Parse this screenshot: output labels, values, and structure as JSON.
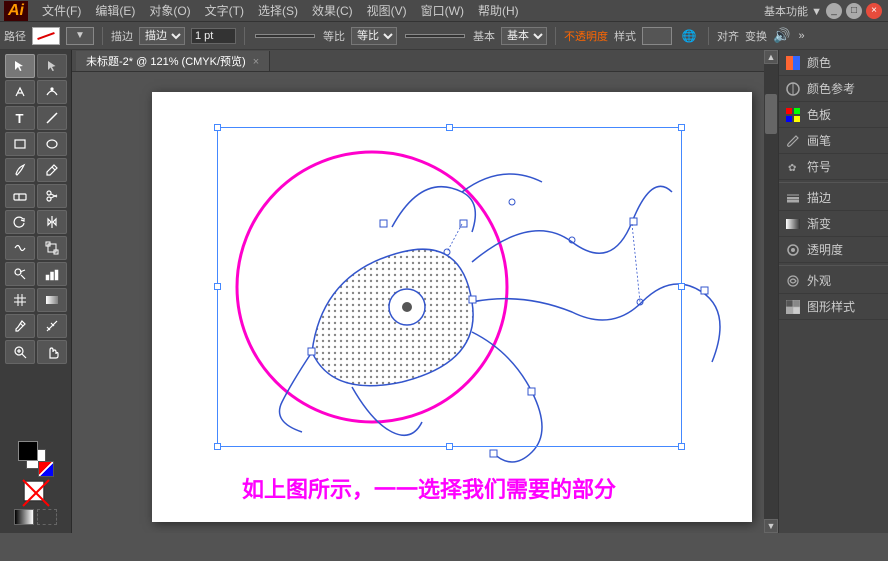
{
  "titlebar": {
    "logo": "Ai",
    "menus": [
      "文件(F)",
      "编辑(E)",
      "对象(O)",
      "文字(T)",
      "选择(S)",
      "效果(C)",
      "视图(V)",
      "窗口(W)",
      "帮助(H)"
    ],
    "profile": "基本功能 ▼",
    "win_buttons": [
      "_",
      "□",
      "×"
    ]
  },
  "toolbar1": {
    "path_label": "路径",
    "stroke_label": "描边",
    "weight_value": "1 pt",
    "blend_label": "等比",
    "opacity_label": "不透明度",
    "style_label": "样式",
    "align_label": "对齐",
    "transform_label": "变换"
  },
  "tabs": [
    {
      "label": "未标题-2* @ 121% (CMYK/预览)",
      "active": true
    }
  ],
  "rightpanel": {
    "items": [
      {
        "icon": "◩",
        "label": "颜色"
      },
      {
        "icon": "◨",
        "label": "颜色参考"
      },
      {
        "icon": "⊞",
        "label": "色板"
      },
      {
        "icon": "✏",
        "label": "画笔"
      },
      {
        "icon": "✿",
        "label": "符号"
      },
      {
        "icon": "—",
        "label": "描边"
      },
      {
        "icon": "▦",
        "label": "渐变"
      },
      {
        "icon": "◎",
        "label": "透明度"
      },
      {
        "icon": "◈",
        "label": "外观"
      },
      {
        "icon": "⬛",
        "label": "图形样式"
      }
    ]
  },
  "caption": {
    "text": "如上图所示，一一选择我们需要的部分"
  },
  "tools": [
    {
      "icon": "↖",
      "label": "selection-tool"
    },
    {
      "icon": "↗",
      "label": "direct-selection-tool"
    },
    {
      "icon": "✎",
      "label": "pen-tool"
    },
    {
      "icon": "T",
      "label": "type-tool"
    },
    {
      "icon": "◯",
      "label": "ellipse-tool"
    },
    {
      "icon": "⬜",
      "label": "rect-tool"
    },
    {
      "icon": "✂",
      "label": "scissors-tool"
    },
    {
      "icon": "⬡",
      "label": "rotate-tool"
    },
    {
      "icon": "↕",
      "label": "scale-tool"
    },
    {
      "icon": "✱",
      "label": "blend-tool"
    },
    {
      "icon": "🖊",
      "label": "pencil-tool"
    },
    {
      "icon": "⊕",
      "label": "symbol-tool"
    },
    {
      "icon": "↔",
      "label": "warp-tool"
    },
    {
      "icon": "⛛",
      "label": "gradient-tool"
    },
    {
      "icon": "◫",
      "label": "mesh-tool"
    },
    {
      "icon": "🔍",
      "label": "zoom-tool"
    },
    {
      "icon": "✋",
      "label": "hand-tool"
    }
  ]
}
